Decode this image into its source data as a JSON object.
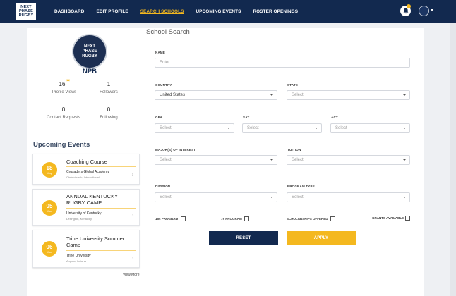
{
  "brand": {
    "logo_lines": [
      "NEXT",
      "PHASE",
      "RUGBY"
    ],
    "accent": "#f4b81f",
    "navy": "#12294f"
  },
  "nav": {
    "items": [
      {
        "label": "DASHBOARD",
        "active": false
      },
      {
        "label": "EDIT PROFILE",
        "active": false
      },
      {
        "label": "SEARCH SCHOOLS",
        "active": true
      },
      {
        "label": "UPCOMING EVENTS",
        "active": false
      },
      {
        "label": "ROSTER OPENINGS",
        "active": false
      }
    ],
    "icons": [
      "bell-icon",
      "avatar",
      "chevron-down-icon"
    ]
  },
  "profile": {
    "name": "NPB",
    "logo_lines": [
      "NEXT",
      "PHASE",
      "RUGBY"
    ],
    "stats": [
      {
        "value": "16",
        "label": "Profile Views"
      },
      {
        "value": "1",
        "label": "Followers"
      },
      {
        "value": "0",
        "label": "Contact Requests"
      },
      {
        "value": "0",
        "label": "Following"
      }
    ]
  },
  "events": {
    "title": "Upcoming Events",
    "items": [
      {
        "day": "18",
        "month": "May",
        "name": "Coaching Course",
        "org": "Crusaders Global Academy",
        "location": "Christchurch, International"
      },
      {
        "day": "05",
        "month": "Jun",
        "name": "ANNUAL KENTUCKY RUGBY CAMP",
        "org": "University of Kentucky",
        "location": "Lexington, Kentucky"
      },
      {
        "day": "06",
        "month": "Jun",
        "name": "Trine University Summer Camp",
        "org": "Trine University",
        "location": "Angola, Indiana"
      }
    ],
    "view_more": "View More"
  },
  "search": {
    "title": "School Search",
    "name": {
      "label": "NAME",
      "placeholder": "Enter"
    },
    "country": {
      "label": "COUNTRY",
      "value": "United States"
    },
    "state": {
      "label": "STATE",
      "value": "Select"
    },
    "gpa": {
      "label": "GPA",
      "value": "Select"
    },
    "sat": {
      "label": "SAT",
      "value": "Select"
    },
    "act": {
      "label": "ACT",
      "value": "Select"
    },
    "major": {
      "label": "MAJOR(S) OF INTEREST",
      "value": "Select"
    },
    "tuition": {
      "label": "TUITION",
      "value": "Select"
    },
    "division": {
      "label": "DIVISION",
      "value": "Select"
    },
    "program_type": {
      "label": "PROGRAM TYPE",
      "value": "Select"
    },
    "checkboxes": [
      {
        "label": "15s PROGRAM",
        "checked": false
      },
      {
        "label": "7s PROGRAM",
        "checked": false
      },
      {
        "label": "SCHOLARSHIPS OFFERED",
        "checked": false
      },
      {
        "label": "GRANTS AVAILABLE",
        "checked": false
      }
    ],
    "reset_label": "RESET",
    "apply_label": "APPLY"
  }
}
